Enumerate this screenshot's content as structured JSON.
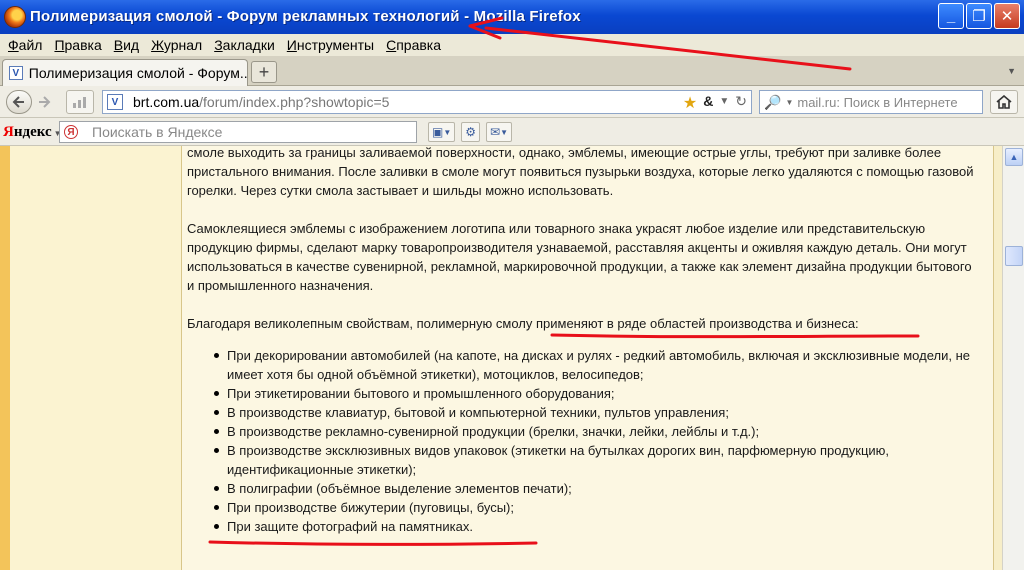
{
  "window": {
    "title": "Полимеризация смолой - Форум рекламных технологий - Mozilla Firefox",
    "minimize_glyph": "_",
    "maximize_glyph": "❐",
    "close_glyph": "✕"
  },
  "menu": {
    "items": [
      {
        "accel": "Ф",
        "rest": "айл"
      },
      {
        "accel": "П",
        "rest": "равка"
      },
      {
        "accel": "В",
        "rest": "ид"
      },
      {
        "accel": "Ж",
        "rest": "урнал"
      },
      {
        "accel": "З",
        "rest": "акладки"
      },
      {
        "accel": "И",
        "rest": "нструменты"
      },
      {
        "accel": "С",
        "rest": "правка"
      }
    ]
  },
  "tabs": {
    "active_label": "Полимеризация смолой - Форум...",
    "new_tab_glyph": "+",
    "list_glyph": "▼"
  },
  "nav": {
    "url_host": "brt.com.ua",
    "url_path": "/forum/index.php?showtopic=5",
    "search_placeholder": "mail.ru: Поиск в Интернете"
  },
  "yandex": {
    "logo_first": "Я",
    "logo_rest": "ндекс",
    "search_placeholder": "Поискать в Яндексе"
  },
  "article": {
    "p1": "смоле выходить за границы заливаемой поверхности, однако, эмблемы, имеющие острые углы, требуют при заливке более пристального внимания. После заливки в смоле могут появиться пузырьки воздуха, которые легко удаляются с помощью газовой горелки. Через сутки смола застывает и шильды можно использовать.",
    "p2": "Самоклеящиеся эмблемы с изображением логотипа или товарного знака украсят любое изделие или представительскую продукцию фирмы, сделают марку товаропроизводителя узнаваемой, расставляя акценты и оживляя каждую деталь. Они могут использоваться в качестве сувенирной, рекламной, маркировочной продукции, а также как элемент дизайна продукции бытового и промышленного назначения.",
    "p3": "Благодаря великолепным свойствам, полимерную смолу применяют в ряде областей производства и бизнеса:",
    "list": [
      "При декорировании автомобилей (на капоте, на дисках и рулях - редкий автомобиль, включая и эксклюзивные модели, не имеет хотя бы одной объёмной этикетки), мотоциклов, велосипедов;",
      "При этикетировании бытового и промышленного оборудования;",
      "В производстве клавиатур, бытовой и компьютерной техники, пультов управления;",
      "В производстве рекламно-сувенирной продукции (брелки, значки, лейки, лейблы и т.д.);",
      "В производстве эксклюзивных видов упаковок (этикетки на бутылках дорогих вин, парфюмерную продукцию, идентификационные этикетки);",
      "В полиграфии (объёмное выделение элементов печати);",
      "При производстве бижутерии (пуговицы, бусы);",
      "При защите фотографий на памятниках."
    ]
  },
  "colors": {
    "annotation_red": "#e8101a",
    "titlebar_blue": "#0a48d2",
    "page_beige": "#fcf7e2"
  }
}
